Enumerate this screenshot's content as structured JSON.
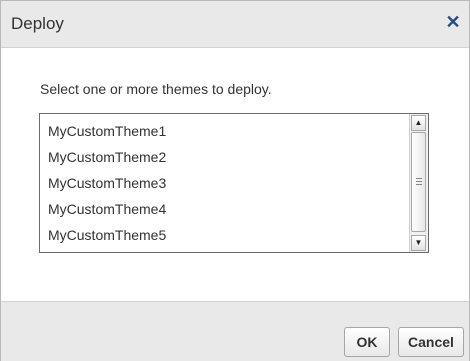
{
  "dialog": {
    "title": "Deploy",
    "close_icon": "close-icon",
    "prompt": "Select one or more themes to deploy.",
    "themes": [
      "MyCustomTheme1",
      "MyCustomTheme2",
      "MyCustomTheme3",
      "MyCustomTheme4",
      "MyCustomTheme5"
    ],
    "ok_label": "OK",
    "cancel_label": "Cancel"
  },
  "colors": {
    "title_bar": "#e9e9e9",
    "close_icon": "#1f4e8a",
    "text": "#333333"
  }
}
